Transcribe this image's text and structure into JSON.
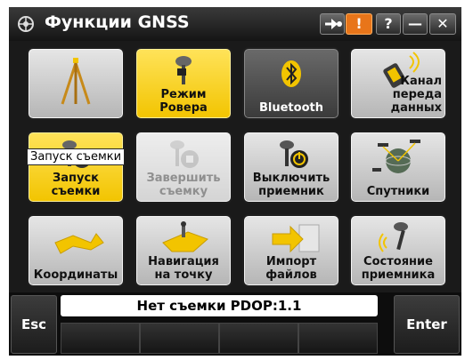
{
  "window": {
    "title": "Функции GNSS",
    "help_label": "?",
    "minimize_label": "—",
    "close_label": "✕",
    "warning_label": "!"
  },
  "tiles": [
    {
      "label": ""
    },
    {
      "label": "Режим\nРовера"
    },
    {
      "label": "Bluetooth"
    },
    {
      "label": "Канал переда\nданных"
    },
    {
      "label": "Запуск\nсъемки"
    },
    {
      "label": "Завершить\nсъемку"
    },
    {
      "label": "Выключить\nприемник"
    },
    {
      "label": "Спутники"
    },
    {
      "label": "Координаты"
    },
    {
      "label": "Навигация\nна точку"
    },
    {
      "label": "Импорт\nфайлов"
    },
    {
      "label": "Состояние\nприемника"
    }
  ],
  "tooltip": "Запуск съемки",
  "status": "Нет съемки  PDOP:1.1",
  "softkeys": {
    "esc": "Esc",
    "enter": "Enter"
  },
  "colors": {
    "accent": "#f2c400",
    "warning": "#e8751a"
  }
}
